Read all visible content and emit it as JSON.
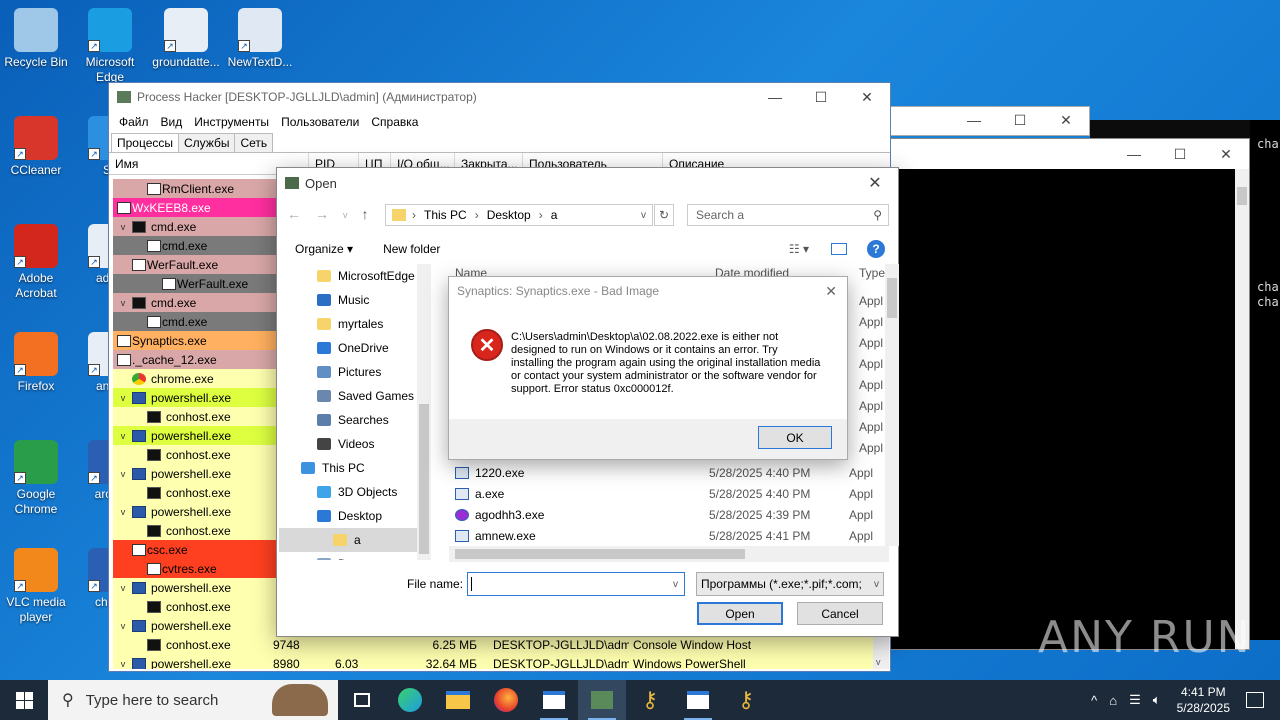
{
  "desktop_icons": [
    {
      "label": "Recycle Bin",
      "color": "#9fc7e8"
    },
    {
      "label": "Microsoft Edge",
      "color": "#1b9de2"
    },
    {
      "label": "groundatte...",
      "color": "#e8eef5"
    },
    {
      "label": "NewTextD...",
      "color": "#dfe8f3"
    },
    {
      "label": "CCleaner",
      "color": "#d9362b"
    },
    {
      "label": "Sk",
      "color": "#2d8fe0"
    },
    {
      "label": "Adobe Acrobat",
      "color": "#d3261c"
    },
    {
      "label": "advic",
      "color": "#e8eef5"
    },
    {
      "label": "Firefox",
      "color": "#f36f21"
    },
    {
      "label": "answ",
      "color": "#e8eef5"
    },
    {
      "label": "Google Chrome",
      "color": "#2a9d4a"
    },
    {
      "label": "aroun",
      "color": "#2b5fb4"
    },
    {
      "label": "VLC media player",
      "color": "#f2871c"
    },
    {
      "label": "charg",
      "color": "#2b5fb4"
    }
  ],
  "process_hacker": {
    "title": "Process Hacker [DESKTOP-JGLLJLD\\admin] (Администратор)",
    "menu": [
      "Файл",
      "Вид",
      "Инструменты",
      "Пользователи",
      "Справка"
    ],
    "tabs": [
      "Процессы",
      "Службы",
      "Сеть"
    ],
    "columns": [
      "Имя",
      "PID",
      "ЦП",
      "I/O общ...",
      "Закрыта...",
      "Пользователь",
      "Описание"
    ],
    "rows": [
      {
        "name": "RmClient.exe",
        "indent": 2,
        "bg": "#d9a7a7",
        "icon": "window",
        "exp": ""
      },
      {
        "name": "WxKEEB8.exe",
        "indent": 0,
        "bg": "#ff2fa0",
        "icon": "window",
        "exp": "",
        "color": "#ffffff"
      },
      {
        "name": "cmd.exe",
        "indent": 0,
        "bg": "#d9a7a7",
        "icon": "cmd",
        "exp": "v"
      },
      {
        "name": "cmd.exe",
        "indent": 2,
        "bg": "#7a7a7a",
        "icon": "window",
        "exp": ""
      },
      {
        "name": "WerFault.exe",
        "indent": 1,
        "bg": "#d9a7a7",
        "icon": "window",
        "exp": "v"
      },
      {
        "name": "WerFault.exe",
        "indent": 3,
        "bg": "#7a7a7a",
        "icon": "window",
        "exp": ""
      },
      {
        "name": "cmd.exe",
        "indent": 0,
        "bg": "#d9a7a7",
        "icon": "cmd",
        "exp": "v"
      },
      {
        "name": "cmd.exe",
        "indent": 2,
        "bg": "#7a7a7a",
        "icon": "window",
        "exp": ""
      },
      {
        "name": "Synaptics.exe",
        "indent": 0,
        "bg": "#ffb060",
        "icon": "window",
        "exp": ""
      },
      {
        "name": "._cache_12.exe",
        "indent": 0,
        "bg": "#d9a7a7",
        "icon": "window",
        "exp": ""
      },
      {
        "name": "chrome.exe",
        "indent": 0,
        "bg": "#ffffb0",
        "icon": "chrome",
        "exp": ""
      },
      {
        "name": "powershell.exe",
        "indent": 0,
        "bg": "#ddff40",
        "icon": "ps",
        "exp": "v"
      },
      {
        "name": "conhost.exe",
        "indent": 1,
        "bg": "#ffffb0",
        "icon": "cmd",
        "exp": ""
      },
      {
        "name": "powershell.exe",
        "indent": 0,
        "bg": "#ddff40",
        "icon": "ps",
        "exp": "v"
      },
      {
        "name": "conhost.exe",
        "indent": 1,
        "bg": "#ffffb0",
        "icon": "cmd",
        "exp": ""
      },
      {
        "name": "powershell.exe",
        "indent": 0,
        "bg": "#ffffb0",
        "icon": "ps",
        "exp": "v"
      },
      {
        "name": "conhost.exe",
        "indent": 1,
        "bg": "#ffffb0",
        "icon": "cmd",
        "exp": ""
      },
      {
        "name": "powershell.exe",
        "indent": 0,
        "bg": "#ffffb0",
        "icon": "ps",
        "exp": "v"
      },
      {
        "name": "conhost.exe",
        "indent": 1,
        "bg": "#ffffb0",
        "icon": "cmd",
        "exp": ""
      },
      {
        "name": "csc.exe",
        "indent": 1,
        "bg": "#ff4020",
        "icon": "window",
        "exp": "v"
      },
      {
        "name": "cvtres.exe",
        "indent": 2,
        "bg": "#ff4020",
        "icon": "window",
        "exp": ""
      },
      {
        "name": "powershell.exe",
        "indent": 0,
        "bg": "#ffffb0",
        "icon": "ps",
        "exp": "v"
      },
      {
        "name": "conhost.exe",
        "indent": 1,
        "bg": "#ffffb0",
        "icon": "cmd",
        "exp": ""
      },
      {
        "name": "powershell.exe",
        "indent": 0,
        "bg": "#ffffb0",
        "icon": "ps",
        "exp": "v"
      },
      {
        "name": "conhost.exe",
        "indent": 1,
        "bg": "#ffffb0",
        "icon": "cmd",
        "exp": "",
        "pid": "9748",
        "cpu": "",
        "mem": "6.25 МБ",
        "user": "DESKTOP-JGLLJLD\\admi",
        "desc": "Console Window Host"
      },
      {
        "name": "powershell.exe",
        "indent": 0,
        "bg": "#ffffb0",
        "icon": "ps",
        "exp": "v",
        "pid": "8980",
        "cpu": "6.03",
        "mem": "32.64 МБ",
        "user": "DESKTOP-JGLLJLD\\admi",
        "desc": "Windows PowerShell"
      }
    ]
  },
  "open_dialog": {
    "title": "Open",
    "breadcrumb": [
      "This PC",
      "Desktop",
      "a"
    ],
    "search_placeholder": "Search a",
    "organize": "Organize ▾",
    "new_folder": "New folder",
    "nav": [
      {
        "label": "MicrosoftEdge",
        "color": "#f7d36b",
        "indent": 1
      },
      {
        "label": "Music",
        "color": "#2b6fc4",
        "indent": 1
      },
      {
        "label": "myrtales",
        "color": "#f7d36b",
        "indent": 1
      },
      {
        "label": "OneDrive",
        "color": "#2b78d6",
        "indent": 1
      },
      {
        "label": "Pictures",
        "color": "#5f8fc4",
        "indent": 1
      },
      {
        "label": "Saved Games",
        "color": "#6a88ad",
        "indent": 1
      },
      {
        "label": "Searches",
        "color": "#5a7fa8",
        "indent": 1
      },
      {
        "label": "Videos",
        "color": "#444444",
        "indent": 1
      },
      {
        "label": "This PC",
        "color": "#3b93e0",
        "indent": 0
      },
      {
        "label": "3D Objects",
        "color": "#3fa4e8",
        "indent": 1
      },
      {
        "label": "Desktop",
        "color": "#2b78d6",
        "indent": 1
      },
      {
        "label": "a",
        "color": "#f7d36b",
        "indent": 2,
        "selected": true
      },
      {
        "label": "Documents",
        "color": "#8aa6c4",
        "indent": 1
      }
    ],
    "columns": [
      "Name",
      "Date modified",
      "Type"
    ],
    "ghost_type": "Appl",
    "files": [
      {
        "name": "1220.exe",
        "date": "5/28/2025 4:40 PM",
        "type": "Appl",
        "icon_color": "#dfe8f3"
      },
      {
        "name": "a.exe",
        "date": "5/28/2025 4:40 PM",
        "type": "Appl",
        "icon_color": "#dfe8f3"
      },
      {
        "name": "agodhh3.exe",
        "date": "5/28/2025 4:39 PM",
        "type": "Appl",
        "icon_color": "#9b2fd6"
      },
      {
        "name": "amnew.exe",
        "date": "5/28/2025 4:41 PM",
        "type": "Appl",
        "icon_color": "#dfe8f3"
      }
    ],
    "filename_label": "File name:",
    "filename_value": "",
    "filter": "Программы (*.exe;*.pif;*.com;",
    "open_btn": "Open",
    "cancel_btn": "Cancel"
  },
  "error_dialog": {
    "title": "Synaptics: Synaptics.exe - Bad Image",
    "message": "C:\\Users\\admin\\Desktop\\a\\02.08.2022.exe is either not designed to run on Windows or it contains an error. Try installing the program again using the original installation media or contact your system administrator or the software vendor for support. Error status 0xc000012f.",
    "ok": "OK"
  },
  "console_window": {
    "side_text": [
      "cha",
      "cha",
      "cha"
    ]
  },
  "watermark": "ANY RUN",
  "taskbar": {
    "search_placeholder": "Type here to search",
    "time": "4:41 PM",
    "date": "5/28/2025"
  }
}
